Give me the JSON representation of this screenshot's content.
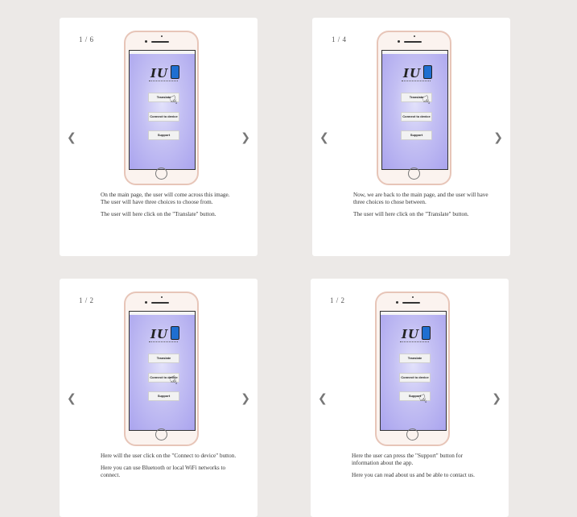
{
  "slides": [
    {
      "counter": "1 / 6",
      "screen_buttons": [
        "Translate",
        "Connect to device",
        "Support"
      ],
      "pointer_target": "Translate",
      "paragraphs": [
        "On the main page, the user will come across this image. The user will have three choices to choose from.",
        "The user will here click on the \"Translate\" button."
      ]
    },
    {
      "counter": "1 / 4",
      "screen_buttons": [
        "Translate",
        "Connect to device",
        "Support"
      ],
      "pointer_target": "Translate",
      "paragraphs": [
        "Now, we are back to the main page, and the user will have three choices to chose between.",
        "The user will here click on the \"Translate\" button."
      ]
    },
    {
      "counter": "1 / 2",
      "screen_buttons": [
        "Translate",
        "Connect to device",
        "Support"
      ],
      "pointer_target": "Connect to device",
      "paragraphs": [
        "Here will the user click on the \"Connect to device\" button.",
        "Here you can use Bluetooth or local WiFi networks to connect."
      ]
    },
    {
      "counter": "1 / 2",
      "screen_buttons": [
        "Translate",
        "Connect to device",
        "Support"
      ],
      "pointer_target": "Support",
      "paragraphs": [
        "Here the user can press the \"Support\" button for information about the app.",
        "Here you can read about us and be able to contact us."
      ]
    }
  ],
  "icons": {
    "prev": "chevron-left-icon",
    "next": "chevron-right-icon",
    "pointer": "pointing-hand-icon"
  },
  "colors": {
    "page_background": "#ece9e7",
    "card_background": "#ffffff",
    "phone_frame": "#e7c5b8",
    "screen_gradient": "#aaa4ee"
  }
}
